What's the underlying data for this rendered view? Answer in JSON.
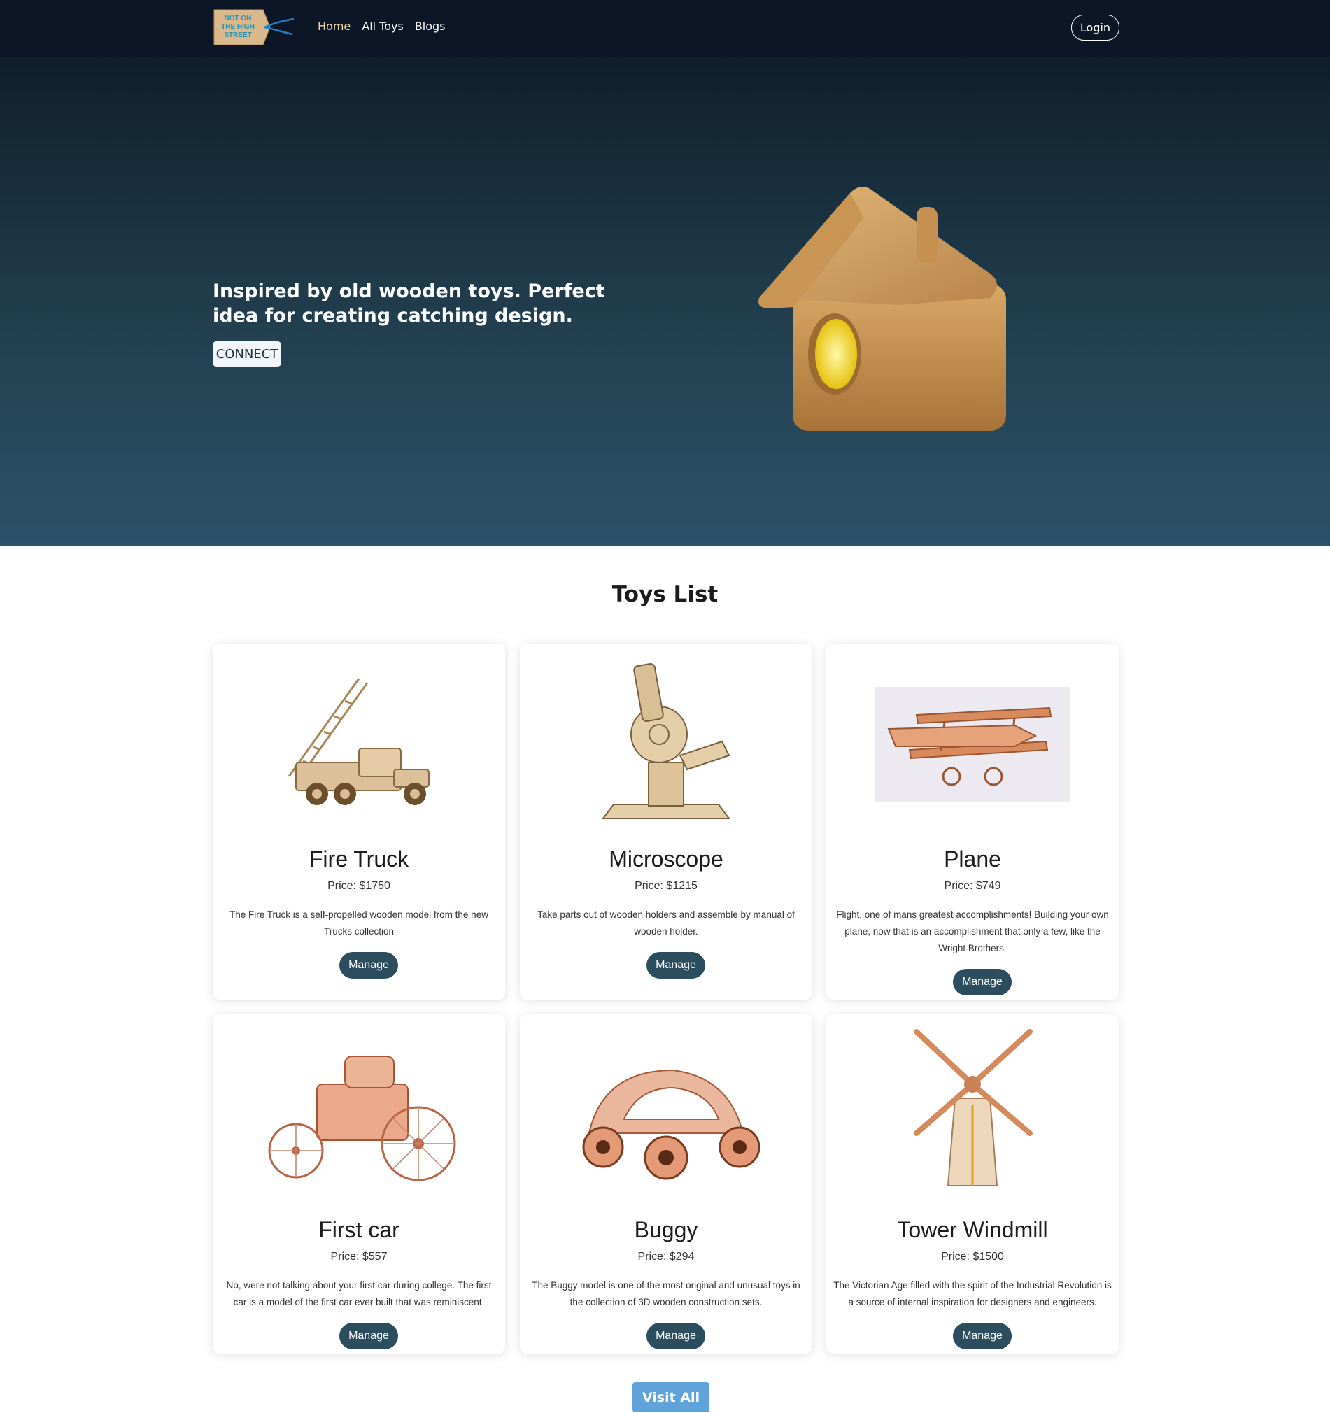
{
  "nav": {
    "logo_text": [
      "NOT ON",
      "THE HIGH",
      "STREET"
    ],
    "links": [
      "Home",
      "All Toys",
      "Blogs"
    ],
    "login": "Login"
  },
  "hero": {
    "heading": "Inspired by old wooden toys. Perfect idea for creating catching design.",
    "button": "CONNECT"
  },
  "toys": {
    "title": "Toys List",
    "items": [
      {
        "name": "Fire Truck",
        "price": "Price: $1750",
        "desc": "The Fire Truck is a self-propelled wooden model from the new Trucks collection",
        "button": "Manage",
        "icon": "fire-truck-image"
      },
      {
        "name": "Microscope",
        "price": "Price: $1215",
        "desc": "Take parts out of wooden holders and assemble by manual of wooden holder.",
        "button": "Manage",
        "icon": "microscope-image"
      },
      {
        "name": "Plane",
        "price": "Price: $749",
        "desc": "Flight, one of mans greatest accomplishments! Building your own plane, now that is an accomplishment that only a few, like the Wright Brothers.",
        "button": "Manage",
        "icon": "plane-image"
      },
      {
        "name": "First car",
        "price": "Price: $557",
        "desc": "No, were not talking about your first car during college. The first car is a model of the first car ever built that was reminiscent.",
        "button": "Manage",
        "icon": "first-car-image"
      },
      {
        "name": "Buggy",
        "price": "Price: $294",
        "desc": "The Buggy model is one of the most original and unusual toys in the collection of 3D wooden construction sets.",
        "button": "Manage",
        "icon": "buggy-image"
      },
      {
        "name": "Tower Windmill",
        "price": "Price: $1500",
        "desc": "The Victorian Age filled with the spirit of the Industrial Revolution is a source of internal inspiration for designers and engineers.",
        "button": "Manage",
        "icon": "windmill-image"
      }
    ],
    "visit_all": "Visit All"
  },
  "colors": {
    "nav_bg": "#0d1627",
    "hero_top": "#0f1f2a",
    "hero_bottom": "#2d5168",
    "manage_btn": "#2b4d5e",
    "visit_btn": "#5fa3da",
    "active_link": "#f3d9a8"
  }
}
